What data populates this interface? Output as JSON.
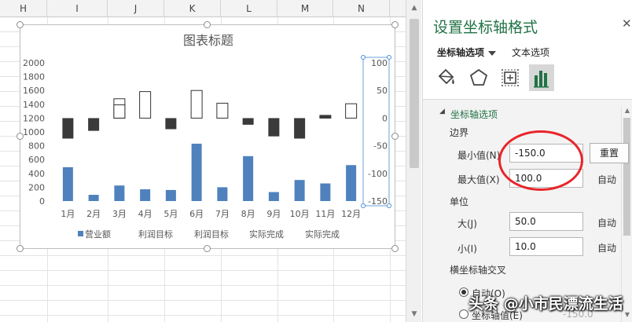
{
  "sheet": {
    "columns": [
      "H",
      "I",
      "J",
      "K",
      "L",
      "M",
      "N"
    ]
  },
  "chart_data": {
    "type": "bar",
    "title": "图表标题",
    "categories": [
      "1月",
      "2月",
      "3月",
      "4月",
      "5月",
      "6月",
      "7月",
      "8月",
      "9月",
      "10月",
      "11月",
      "12月"
    ],
    "series": [
      {
        "name": "营业额",
        "axis": "primary",
        "values": [
          490,
          90,
          225,
          170,
          160,
          830,
          200,
          650,
          130,
          305,
          255,
          520
        ]
      },
      {
        "name": "利润目标",
        "axis": "secondary",
        "values": [
          0,
          0,
          35,
          48,
          0,
          50,
          27,
          0,
          0,
          0,
          0,
          0
        ]
      },
      {
        "name": "利润目标",
        "axis": "secondary",
        "values": [
          0,
          0,
          0,
          0,
          0,
          0,
          0,
          0,
          0,
          0,
          0,
          0
        ]
      },
      {
        "name": "实际完成",
        "axis": "secondary",
        "values": [
          -37,
          -23,
          24,
          0,
          -20,
          0,
          0,
          -12,
          -33,
          -37,
          5,
          26
        ]
      },
      {
        "name": "实际完成",
        "axis": "secondary",
        "values": [
          0,
          0,
          0,
          0,
          0,
          0,
          0,
          0,
          0,
          0,
          0,
          0
        ]
      }
    ],
    "primary_ylim": [
      0,
      2000
    ],
    "primary_ticks": [
      "2000",
      "1800",
      "1600",
      "1400",
      "1200",
      "1000",
      "800",
      "600",
      "400",
      "200",
      "0"
    ],
    "secondary_ylim": [
      -150,
      100
    ],
    "secondary_ticks": [
      "100",
      "50",
      "0",
      "-50",
      "-100",
      "-150"
    ],
    "legend": [
      "营业额",
      "利润目标",
      "利润目标",
      "实际完成",
      "实际完成"
    ],
    "legend_position": "bottom",
    "colors": {
      "primary": "#4f81bd",
      "negative": "#3a3a3a",
      "positive_fill": "#ffffff",
      "positive_border": "#333333"
    }
  },
  "pane": {
    "title": "设置坐标轴格式",
    "close": "✕",
    "tab_axis": "坐标轴选项",
    "tab_text": "文本选项",
    "section": "坐标轴选项",
    "bounds_label": "边界",
    "min_label": "最小值(N)",
    "min_value": "-150.0",
    "min_button": "重置",
    "max_label": "最大值(X)",
    "max_value": "100.0",
    "max_status": "自动",
    "units_label": "单位",
    "major_label": "大(J)",
    "major_value": "50.0",
    "major_status": "自动",
    "minor_label": "小(I)",
    "minor_value": "10.0",
    "minor_status": "自动",
    "cross_label": "横坐标轴交叉",
    "cross_auto": "自动(O)",
    "cross_value_label": "坐标轴值(E)",
    "cross_value": "-150.0"
  },
  "watermark": "头条 @小市民漂流生活"
}
